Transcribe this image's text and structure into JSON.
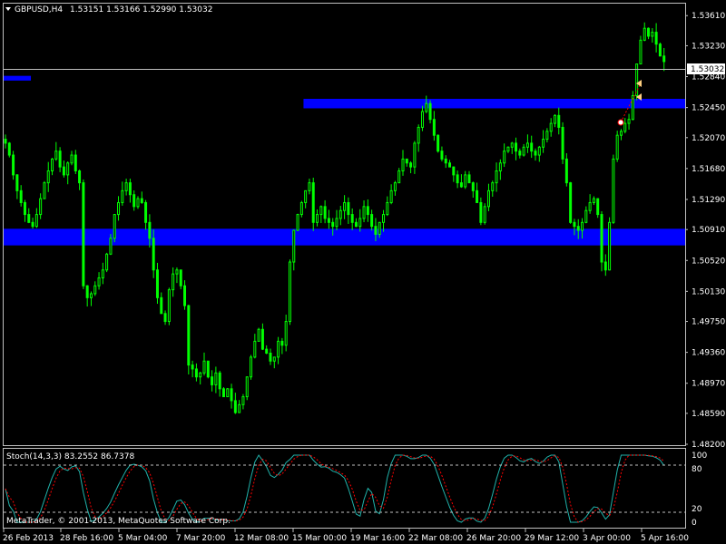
{
  "window": {
    "dropdown_icon": "triangle-down-icon",
    "title": "GBPUSD,H4",
    "ohlc": "1.53151 1.53166 1.52990 1.53032",
    "current_price": "1.53032"
  },
  "price_axis": [
    "1.53610",
    "1.53230",
    "1.52840",
    "1.52450",
    "1.52070",
    "1.51680",
    "1.51290",
    "1.50910",
    "1.50520",
    "1.50130",
    "1.49750",
    "1.49360",
    "1.48970",
    "1.48590",
    "1.48200"
  ],
  "time_axis": [
    "26 Feb 2013",
    "28 Feb 16:00",
    "5 Mar 04:00",
    "7 Mar 20:00",
    "12 Mar 08:00",
    "15 Mar 00:00",
    "19 Mar 16:00",
    "22 Mar 08:00",
    "26 Mar 20:00",
    "29 Mar 12:00",
    "3 Apr 00:00",
    "5 Apr 16:00"
  ],
  "stoch_panel": {
    "header": "Stoch(14,3,3) 83.2552 86.7378",
    "axis": [
      "100",
      "80",
      "20",
      "0"
    ],
    "footer": "MetaTrader, © 2001-2013, MetaQuotes Software Corp."
  },
  "zones": [
    {
      "from": 1.5256,
      "to": 1.5244,
      "start": 0.44,
      "end": 1.0,
      "color": "#0000ff"
    },
    {
      "from": 1.5092,
      "to": 1.5071,
      "start": 0.0,
      "end": 1.0,
      "color": "#0000ff"
    },
    {
      "from": 1.5285,
      "to": 1.5279,
      "start": 0.0,
      "end": 0.04,
      "color": "#0000ff"
    }
  ],
  "colors": {
    "background": "#000000",
    "candles": "#00ff00",
    "zone": "#0000ff",
    "grid": "#c0c0c0",
    "stoch_main": "#20b2aa",
    "stoch_signal": "#ff0000",
    "text": "#ffffff"
  },
  "chart_data": {
    "type": "candlestick",
    "symbol": "GBPUSD",
    "timeframe": "H4",
    "ylim": [
      1.482,
      1.5375
    ],
    "closes": [
      1.52,
      1.5185,
      1.516,
      1.514,
      1.5125,
      1.511,
      1.51,
      1.5095,
      1.511,
      1.513,
      1.515,
      1.5165,
      1.518,
      1.519,
      1.517,
      1.516,
      1.5175,
      1.5185,
      1.5165,
      1.515,
      1.502,
      1.5005,
      1.501,
      1.502,
      1.503,
      1.504,
      1.506,
      1.508,
      1.511,
      1.5125,
      1.514,
      1.515,
      1.5135,
      1.512,
      1.513,
      1.5125,
      1.51,
      1.508,
      1.504,
      1.5005,
      1.4985,
      1.4975,
      1.5015,
      1.5035,
      1.504,
      1.502,
      1.4995,
      1.492,
      1.4915,
      1.4905,
      1.491,
      1.4925,
      1.4905,
      1.4895,
      1.491,
      1.489,
      1.488,
      1.489,
      1.4875,
      1.486,
      1.487,
      1.488,
      1.4905,
      1.493,
      1.495,
      1.4965,
      1.494,
      1.4935,
      1.4925,
      1.493,
      1.495,
      1.4945,
      1.4975,
      1.505,
      1.509,
      1.511,
      1.5125,
      1.514,
      1.515,
      1.51,
      1.511,
      1.512,
      1.5105,
      1.51,
      1.5095,
      1.5105,
      1.5115,
      1.5125,
      1.511,
      1.51,
      1.5095,
      1.5105,
      1.512,
      1.511,
      1.5095,
      1.5085,
      1.51,
      1.511,
      1.5125,
      1.514,
      1.515,
      1.5165,
      1.518,
      1.5175,
      1.517,
      1.52,
      1.522,
      1.524,
      1.525,
      1.523,
      1.521,
      1.519,
      1.518,
      1.5175,
      1.517,
      1.516,
      1.515,
      1.5145,
      1.516,
      1.515,
      1.514,
      1.5125,
      1.51,
      1.512,
      1.514,
      1.515,
      1.5165,
      1.5175,
      1.519,
      1.5195,
      1.52,
      1.519,
      1.5185,
      1.5195,
      1.52,
      1.519,
      1.5185,
      1.5195,
      1.5205,
      1.5215,
      1.5225,
      1.5235,
      1.522,
      1.518,
      1.515,
      1.51,
      1.5095,
      1.509,
      1.51,
      1.5115,
      1.5125,
      1.513,
      1.511,
      1.505,
      1.504,
      1.51,
      1.518,
      1.521,
      1.5215,
      1.5225,
      1.523,
      1.526,
      1.53,
      1.533,
      1.5345,
      1.5335,
      1.534,
      1.5325,
      1.531,
      1.5303
    ]
  }
}
